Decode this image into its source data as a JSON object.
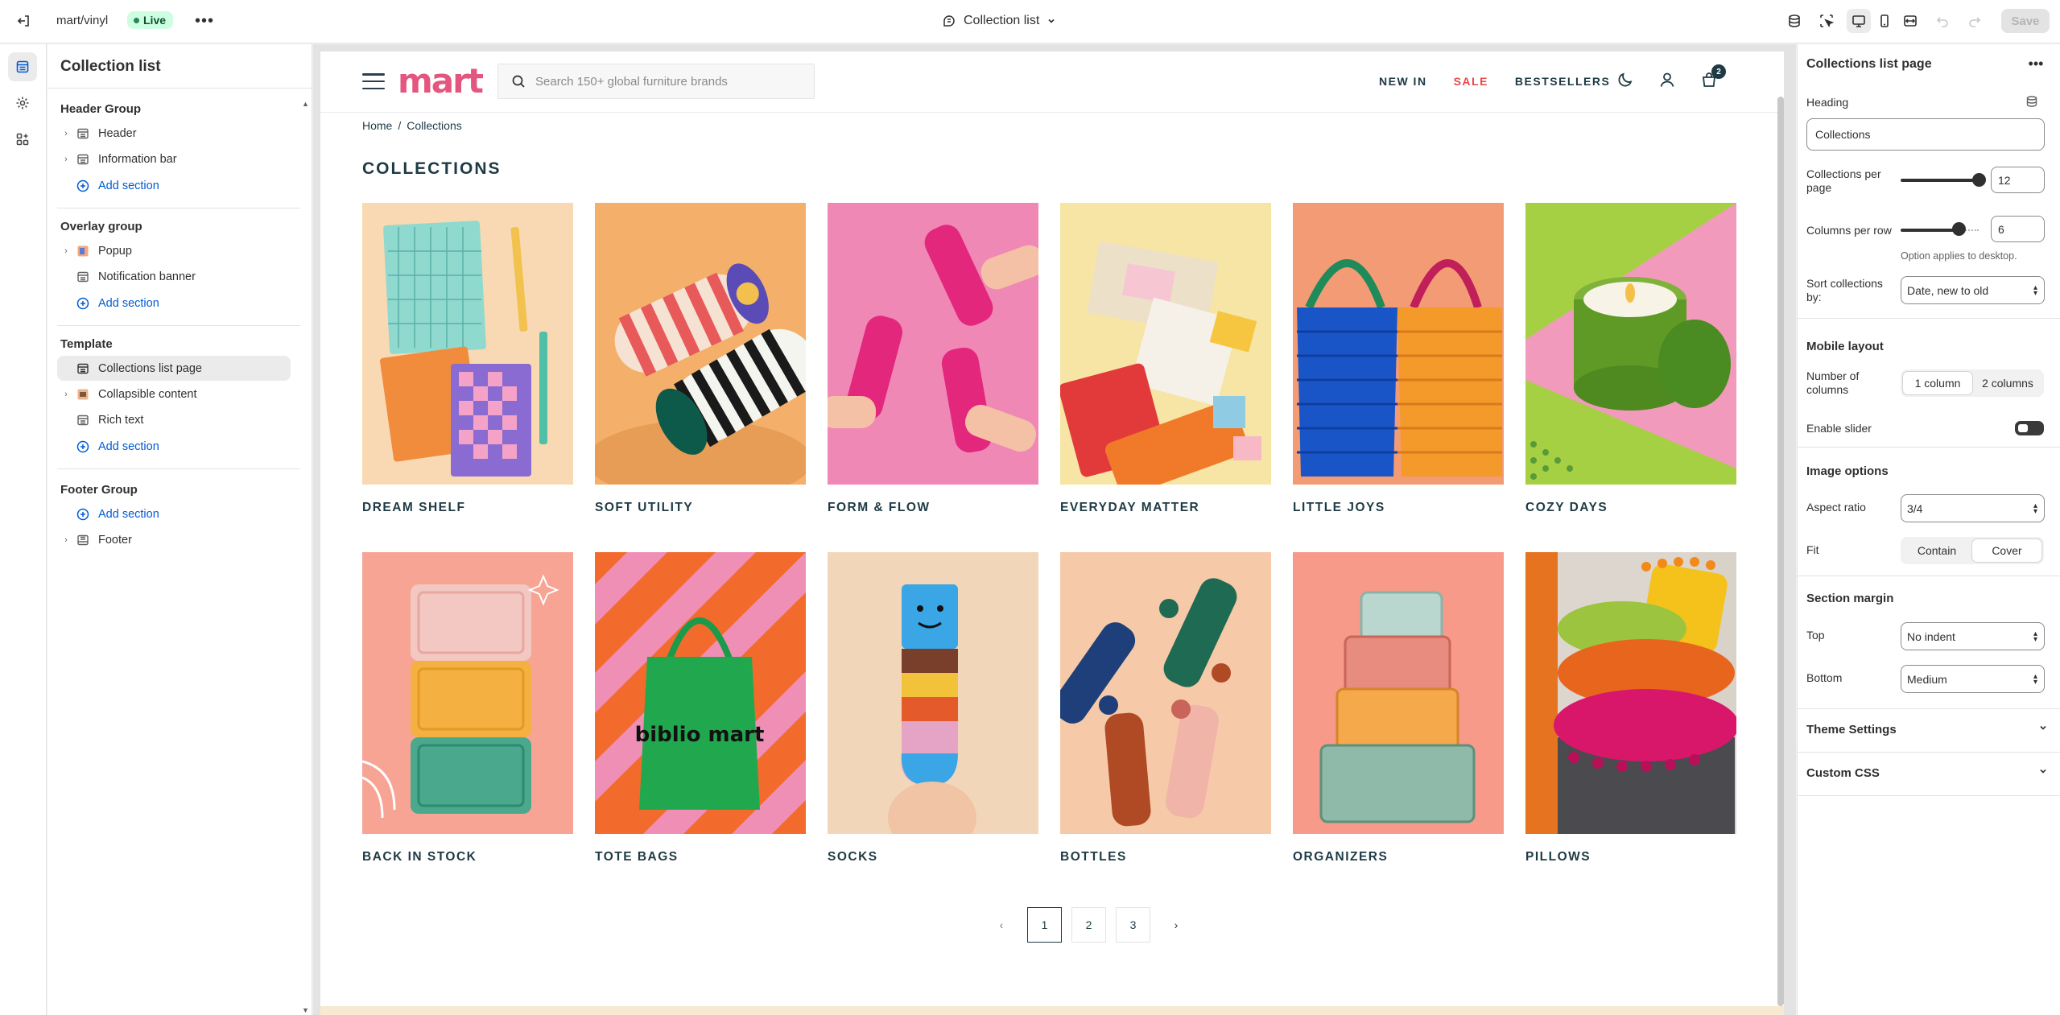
{
  "topbar": {
    "store_name": "mart/vinyl",
    "status": "Live",
    "template_name": "Collection list",
    "save_label": "Save"
  },
  "left_panel": {
    "title": "Collection list",
    "groups": [
      {
        "title": "Header Group",
        "items": [
          "Header",
          "Information bar"
        ],
        "add": "Add section"
      },
      {
        "title": "Overlay group",
        "items": [
          "Popup",
          "Notification banner"
        ],
        "add": "Add section"
      },
      {
        "title": "Template",
        "items": [
          "Collections list page",
          "Collapsible content",
          "Rich text"
        ],
        "add": "Add section"
      },
      {
        "title": "Footer Group",
        "add": "Add section",
        "items": [
          "Footer"
        ]
      }
    ]
  },
  "preview": {
    "logo": "mart",
    "search_placeholder": "Search 150+ global furniture brands",
    "nav": [
      "NEW IN",
      "SALE",
      "BESTSELLERS"
    ],
    "cart_count": "2",
    "breadcrumb": {
      "home": "Home",
      "sep": "/",
      "current": "Collections"
    },
    "title": "COLLECTIONS",
    "collections": [
      "DREAM SHELF",
      "SOFT UTILITY",
      "FORM & FLOW",
      "EVERYDAY MATTER",
      "LITTLE JOYS",
      "COZY DAYS",
      "BACK IN STOCK",
      "TOTE BAGS",
      "SOCKS",
      "BOTTLES",
      "ORGANIZERS",
      "PILLOWS"
    ],
    "image_text": {
      "tote": "biblio mart"
    },
    "pagination": {
      "pages": [
        "1",
        "2",
        "3"
      ],
      "current": "1"
    }
  },
  "right_panel": {
    "title": "Collections list page",
    "heading_label": "Heading",
    "heading_value": "Collections",
    "per_page_label": "Collections per page",
    "per_page_value": "12",
    "per_page_fraction": 1.0,
    "per_row_label": "Columns per row",
    "per_row_value": "6",
    "per_row_fraction": 0.8,
    "per_row_help": "Option applies to desktop.",
    "sort_label": "Sort collections by:",
    "sort_value": "Date, new to old",
    "mobile_title": "Mobile layout",
    "num_cols_label": "Number of columns",
    "num_cols_options": [
      "1 column",
      "2 columns"
    ],
    "num_cols_selected": "1 column",
    "slider_label": "Enable slider",
    "slider_enabled": false,
    "image_title": "Image options",
    "aspect_label": "Aspect ratio",
    "aspect_value": "3/4",
    "fit_label": "Fit",
    "fit_options": [
      "Contain",
      "Cover"
    ],
    "fit_selected": "Cover",
    "margin_title": "Section margin",
    "top_label": "Top",
    "top_value": "No indent",
    "bottom_label": "Bottom",
    "bottom_value": "Medium",
    "theme_settings": "Theme Settings",
    "custom_css": "Custom CSS"
  },
  "colors": {
    "accent": "#005bd3",
    "live_bg": "#cdfee1",
    "brand_pink": "#e4567f",
    "navy": "#1e3a44",
    "sale": "#e84a4a"
  }
}
